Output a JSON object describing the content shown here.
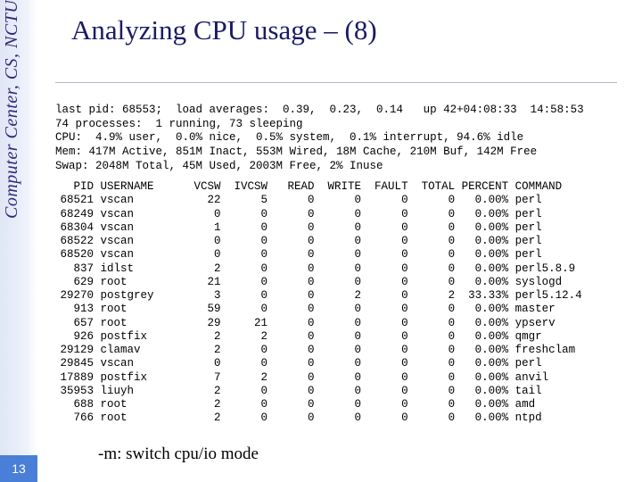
{
  "page_number": "13",
  "side_label": "Computer Center, CS, NCTU",
  "title": "Analyzing CPU usage – (8)",
  "chart_data": {
    "type": "table",
    "header_lines": [
      "last pid: 68553;  load averages:  0.39,  0.23,  0.14   up 42+04:08:33  14:58:53",
      "74 processes:  1 running, 73 sleeping",
      "CPU:  4.9% user,  0.0% nice,  0.5% system,  0.1% interrupt, 94.6% idle",
      "Mem: 417M Active, 851M Inact, 553M Wired, 18M Cache, 210M Buf, 142M Free",
      "Swap: 2048M Total, 45M Used, 2003M Free, 2% Inuse"
    ],
    "columns": [
      "PID",
      "USERNAME",
      "VCSW",
      "IVCSW",
      "READ",
      "WRITE",
      "FAULT",
      "TOTAL",
      "PERCENT",
      "COMMAND"
    ],
    "rows": [
      [
        "68521",
        "vscan",
        "22",
        "5",
        "0",
        "0",
        "0",
        "0",
        "0.00%",
        "perl"
      ],
      [
        "68249",
        "vscan",
        "0",
        "0",
        "0",
        "0",
        "0",
        "0",
        "0.00%",
        "perl"
      ],
      [
        "68304",
        "vscan",
        "1",
        "0",
        "0",
        "0",
        "0",
        "0",
        "0.00%",
        "perl"
      ],
      [
        "68522",
        "vscan",
        "0",
        "0",
        "0",
        "0",
        "0",
        "0",
        "0.00%",
        "perl"
      ],
      [
        "68520",
        "vscan",
        "0",
        "0",
        "0",
        "0",
        "0",
        "0",
        "0.00%",
        "perl"
      ],
      [
        "837",
        "idlst",
        "2",
        "0",
        "0",
        "0",
        "0",
        "0",
        "0.00%",
        "perl5.8.9"
      ],
      [
        "629",
        "root",
        "21",
        "0",
        "0",
        "0",
        "0",
        "0",
        "0.00%",
        "syslogd"
      ],
      [
        "29270",
        "postgrey",
        "3",
        "0",
        "0",
        "2",
        "0",
        "2",
        "33.33%",
        "perl5.12.4"
      ],
      [
        "913",
        "root",
        "59",
        "0",
        "0",
        "0",
        "0",
        "0",
        "0.00%",
        "master"
      ],
      [
        "657",
        "root",
        "29",
        "21",
        "0",
        "0",
        "0",
        "0",
        "0.00%",
        "ypserv"
      ],
      [
        "926",
        "postfix",
        "2",
        "2",
        "0",
        "0",
        "0",
        "0",
        "0.00%",
        "qmgr"
      ],
      [
        "29129",
        "clamav",
        "2",
        "0",
        "0",
        "0",
        "0",
        "0",
        "0.00%",
        "freshclam"
      ],
      [
        "29845",
        "vscan",
        "0",
        "0",
        "0",
        "0",
        "0",
        "0",
        "0.00%",
        "perl"
      ],
      [
        "17889",
        "postfix",
        "7",
        "2",
        "0",
        "0",
        "0",
        "0",
        "0.00%",
        "anvil"
      ],
      [
        "35953",
        "liuyh",
        "2",
        "0",
        "0",
        "0",
        "0",
        "0",
        "0.00%",
        "tail"
      ],
      [
        "688",
        "root",
        "2",
        "0",
        "0",
        "0",
        "0",
        "0",
        "0.00%",
        "amd"
      ],
      [
        "766",
        "root",
        "2",
        "0",
        "0",
        "0",
        "0",
        "0",
        "0.00%",
        "ntpd"
      ]
    ]
  },
  "footnote": "-m: switch cpu/io mode"
}
